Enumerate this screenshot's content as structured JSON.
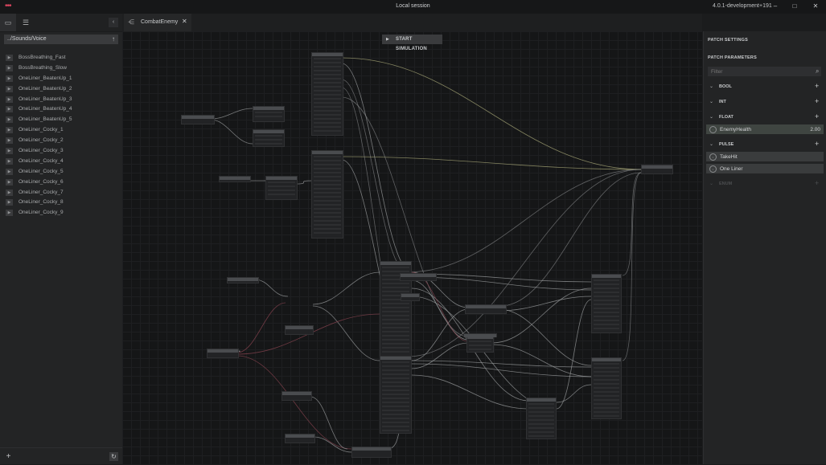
{
  "window": {
    "title": "Local session",
    "version": "4.0.1-development+191"
  },
  "left_panel": {
    "path": "../Sounds/Voice",
    "items": [
      {
        "label": "BossBreathing_Fast"
      },
      {
        "label": "BossBreathing_Slow"
      },
      {
        "label": "OneLiner_BeatenUp_1"
      },
      {
        "label": "OneLiner_BeatenUp_2"
      },
      {
        "label": "OneLiner_BeatenUp_3"
      },
      {
        "label": "OneLiner_BeatenUp_4"
      },
      {
        "label": "OneLiner_BeatenUp_5"
      },
      {
        "label": "OneLiner_Cocky_1"
      },
      {
        "label": "OneLiner_Cocky_2"
      },
      {
        "label": "OneLiner_Cocky_3"
      },
      {
        "label": "OneLiner_Cocky_4"
      },
      {
        "label": "OneLiner_Cocky_5"
      },
      {
        "label": "OneLiner_Cocky_6"
      },
      {
        "label": "OneLiner_Cocky_7"
      },
      {
        "label": "OneLiner_Cocky_8"
      },
      {
        "label": "OneLiner_Cocky_9"
      }
    ]
  },
  "tabs": [
    {
      "label": "CombatEnemy"
    }
  ],
  "graph": {
    "simulate_label": "START SIMULATION"
  },
  "right_panel": {
    "settings_heading": "PATCH SETTINGS",
    "params_heading": "PATCH PARAMETERS",
    "filter_placeholder": "Filter",
    "sections": {
      "bool": "BOOL",
      "int": "INT",
      "float": "FLOAT",
      "pulse": "PULSE",
      "enum": "ENUM"
    },
    "float_params": [
      {
        "name": "EnemyHealth",
        "value": "2.00"
      }
    ],
    "pulse_params": [
      {
        "name": "TakeHit"
      },
      {
        "name": "One Liner"
      }
    ]
  },
  "colors": {
    "accent_float": "#3f4541",
    "wire_default": "#9a9c9e",
    "wire_yellow": "#a8a878",
    "wire_red": "#8a4450",
    "app_logo": "#d8445e"
  }
}
